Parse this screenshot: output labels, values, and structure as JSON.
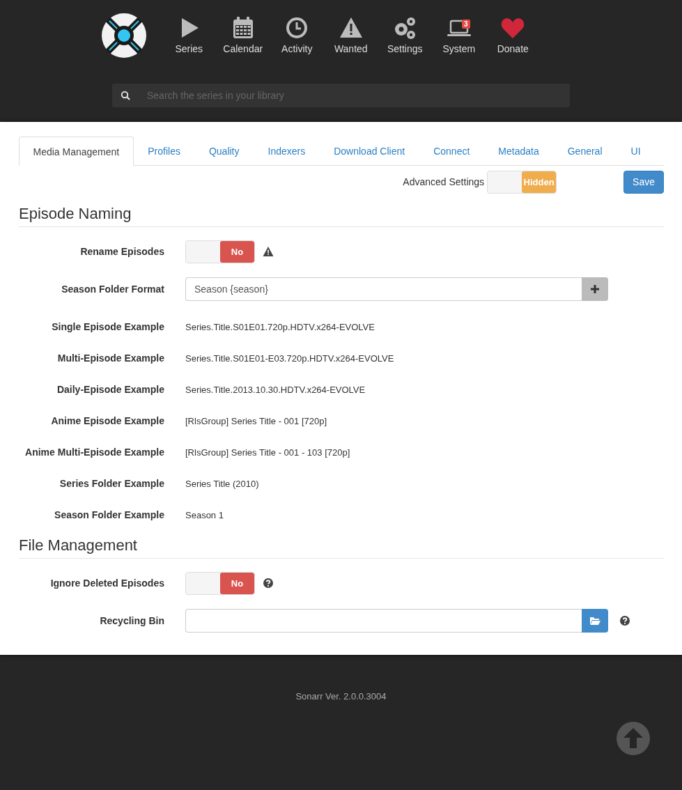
{
  "nav": {
    "items": [
      {
        "label": "Series"
      },
      {
        "label": "Calendar"
      },
      {
        "label": "Activity"
      },
      {
        "label": "Wanted"
      },
      {
        "label": "Settings"
      },
      {
        "label": "System",
        "badge": "3"
      },
      {
        "label": "Donate"
      }
    ]
  },
  "search": {
    "placeholder": "Search the series in your library"
  },
  "tabs": [
    {
      "label": "Media Management",
      "selected": true
    },
    {
      "label": "Profiles",
      "selected": false
    },
    {
      "label": "Quality",
      "selected": false
    },
    {
      "label": "Indexers",
      "selected": false
    },
    {
      "label": "Download Client",
      "selected": false
    },
    {
      "label": "Connect",
      "selected": false
    },
    {
      "label": "Metadata",
      "selected": false
    },
    {
      "label": "General",
      "selected": false
    },
    {
      "label": "UI",
      "selected": false
    }
  ],
  "advanced_settings": {
    "label": "Advanced Settings",
    "value": "Hidden",
    "on": false
  },
  "save_button": "Save",
  "sections": [
    {
      "title": "Episode Naming",
      "rows": [
        {
          "kind": "toggle",
          "label": "Rename Episodes",
          "value": "No",
          "on": false
        },
        {
          "kind": "input",
          "label": "Season Folder Format",
          "value": "Season {season}"
        },
        {
          "kind": "example",
          "label": "Single Episode Example",
          "value": "Series.Title.S01E01.720p.HDTV.x264-EVOLVE"
        },
        {
          "kind": "example",
          "label": "Multi-Episode Example",
          "value": "Series.Title.S01E01-E03.720p.HDTV.x264-EVOLVE"
        },
        {
          "kind": "example",
          "label": "Daily-Episode Example",
          "value": "Series.Title.2013.10.30.HDTV.x264-EVOLVE"
        },
        {
          "kind": "example",
          "label": "Anime Episode Example",
          "value": "[RlsGroup] Series Title - 001 [720p]"
        },
        {
          "kind": "example",
          "label": "Anime Multi-Episode Example",
          "value": "[RlsGroup] Series Title - 001 - 103 [720p]"
        },
        {
          "kind": "example",
          "label": "Series Folder Example",
          "value": "Series Title (2010)"
        },
        {
          "kind": "example",
          "label": "Season Folder Example",
          "value": "Season 1"
        }
      ]
    },
    {
      "title": "File Management",
      "rows": [
        {
          "kind": "toggle",
          "label": "Ignore Deleted Episodes",
          "value": "No",
          "on": false
        },
        {
          "kind": "input",
          "label": "Recycling Bin"
        }
      ]
    }
  ],
  "footer": {
    "version": "Sonarr Ver. 2.0.0.3004"
  }
}
